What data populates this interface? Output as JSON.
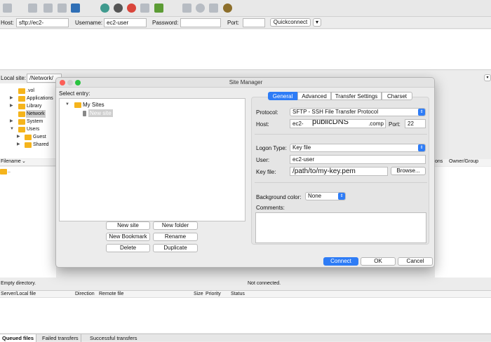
{
  "quickconnect": {
    "host_label": "Host:",
    "host_value": "sftp://ec2-",
    "username_label": "Username:",
    "username_value": "ec2-user",
    "password_label": "Password:",
    "password_value": "",
    "port_label": "Port:",
    "port_value": "",
    "button_label": "Quickconnect"
  },
  "local": {
    "site_label": "Local site:",
    "site_path": "/Network/",
    "tree": [
      {
        "name": ".vol",
        "expander": ""
      },
      {
        "name": "Applications",
        "expander": "▶"
      },
      {
        "name": "Library",
        "expander": "▶"
      },
      {
        "name": "Network",
        "expander": ""
      },
      {
        "name": "System",
        "expander": "▶"
      },
      {
        "name": "Users",
        "expander": "▼"
      },
      {
        "name": "Guest",
        "expander": "▶"
      },
      {
        "name": "Shared",
        "expander": "▶"
      }
    ],
    "list_header": "Filename",
    "list_first_row": "..",
    "status": "Empty directory."
  },
  "remote": {
    "col_permissions": "ons",
    "col_owner": "Owner/Group",
    "status": "Not connected."
  },
  "queue": {
    "columns": [
      "Server/Local file",
      "Direction",
      "Remote file",
      "Size",
      "Priority",
      "Status"
    ],
    "tabs": [
      "Queued files",
      "Failed transfers",
      "Successful transfers"
    ]
  },
  "dialog": {
    "title": "Site Manager",
    "select_entry_label": "Select entry:",
    "tree": {
      "root": "My Sites",
      "child": "New site"
    },
    "buttons": {
      "new_site": "New site",
      "new_folder": "New folder",
      "new_bookmark": "New Bookmark",
      "rename": "Rename",
      "delete": "Delete",
      "duplicate": "Duplicate",
      "connect": "Connect",
      "ok": "OK",
      "cancel": "Cancel",
      "browse": "Browse..."
    },
    "tabs": [
      "General",
      "Advanced",
      "Transfer Settings",
      "Charset"
    ],
    "active_tab": "General",
    "general": {
      "protocol_label": "Protocol:",
      "protocol_value": "SFTP - SSH File Transfer Protocol",
      "host_label": "Host:",
      "host_prefix": "ec2-",
      "host_overlay": "publicDNS",
      "host_suffix": ".comp",
      "port_label": "Port:",
      "port_value": "22",
      "logon_type_label": "Logon Type:",
      "logon_type_value": "Key file",
      "user_label": "User:",
      "user_value": "ec2-user",
      "keyfile_label": "Key file:",
      "keyfile_value": "/path/to/my-key.pem",
      "bg_color_label": "Background color:",
      "bg_color_value": "None",
      "comments_label": "Comments:",
      "comments_value": ""
    }
  },
  "colors": {
    "accent": "#2e7cf6",
    "folder": "#f5b41c",
    "selection": "#cfcfcf"
  }
}
